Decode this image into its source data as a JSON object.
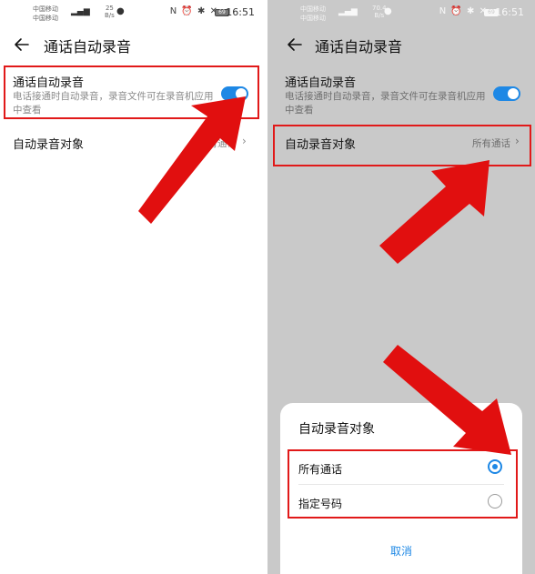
{
  "status_bar": {
    "carrier_lines": [
      "中国移动",
      "中国移动"
    ],
    "speed_top": "25",
    "speed_unit": "B/s",
    "speed_top_right": "70.4",
    "speed_unit_right": "B/s",
    "battery": "69",
    "time": "16:51"
  },
  "header": {
    "title": "通话自动录音"
  },
  "setting_auto_record": {
    "title": "通话自动录音",
    "description": "电话接通时自动录音，录音文件可在录音机应用中查看",
    "enabled": true
  },
  "setting_target": {
    "title": "自动录音对象",
    "value": "所有通话"
  },
  "dialog": {
    "title": "自动录音对象",
    "options": [
      {
        "label": "所有通话",
        "selected": true
      },
      {
        "label": "指定号码",
        "selected": false
      }
    ],
    "cancel_label": "取消"
  },
  "colors": {
    "accent": "#1e88e5",
    "highlight": "#e11919",
    "dim_overlay": "#c9c9c9"
  }
}
